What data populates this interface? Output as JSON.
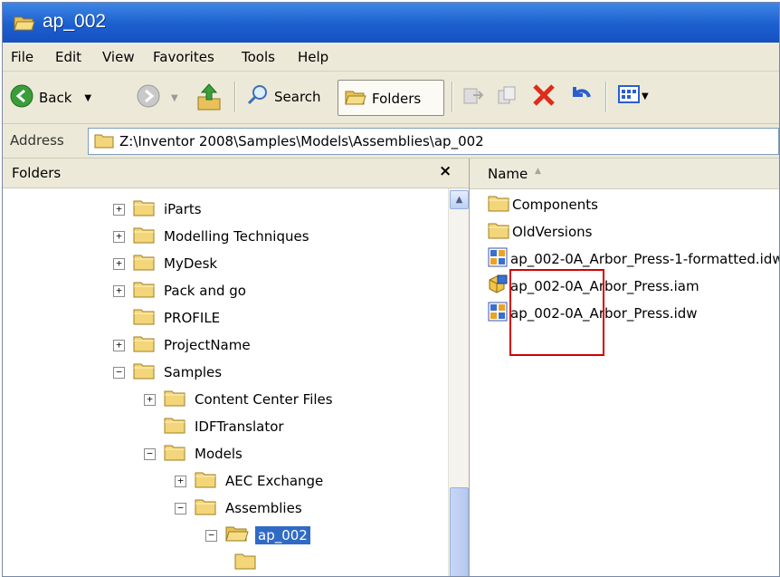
{
  "window": {
    "title": "ap_002"
  },
  "menu": [
    "File",
    "Edit",
    "View",
    "Favorites",
    "Tools",
    "Help"
  ],
  "toolbar": {
    "back_label": "Back",
    "search_label": "Search",
    "folders_label": "Folders"
  },
  "address": {
    "label": "Address",
    "path": "Z:\\Inventor 2008\\Samples\\Models\\Assemblies\\ap_002"
  },
  "folders_pane": {
    "title": "Folders",
    "close_symbol": "×",
    "tree": [
      {
        "label": "iParts",
        "expander": "+"
      },
      {
        "label": "Modelling Techniques",
        "expander": "+"
      },
      {
        "label": "MyDesk",
        "expander": "+"
      },
      {
        "label": "Pack and go",
        "expander": "+"
      },
      {
        "label": "PROFILE",
        "expander": ""
      },
      {
        "label": "ProjectName",
        "expander": "+"
      },
      {
        "label": "Samples",
        "expander": "−"
      },
      {
        "label": "Content Center Files",
        "expander": "+"
      },
      {
        "label": "IDFTranslator",
        "expander": ""
      },
      {
        "label": "Models",
        "expander": "−"
      },
      {
        "label": "AEC Exchange",
        "expander": "+"
      },
      {
        "label": "Assemblies",
        "expander": "−"
      },
      {
        "label": "ap_002",
        "expander": "−",
        "selected": true
      }
    ]
  },
  "files_pane": {
    "column_name": "Name",
    "sort_arrow": "▲",
    "files": [
      {
        "label": "Components",
        "icon": "folder-icon"
      },
      {
        "label": "OldVersions",
        "icon": "folder-icon"
      },
      {
        "label": "ap_002-0A_Arbor_Press-1-formatted.idw",
        "icon": "drawing-icon"
      },
      {
        "label": "ap_002-0A_Arbor_Press.iam",
        "icon": "assembly-icon"
      },
      {
        "label": "ap_002-0A_Arbor_Press.idw",
        "icon": "drawing-icon"
      }
    ]
  },
  "colors": {
    "title_bar": "#1c5fce",
    "selection": "#316ac5",
    "highlight_box": "#d40000",
    "chrome": "#ece9d8"
  }
}
